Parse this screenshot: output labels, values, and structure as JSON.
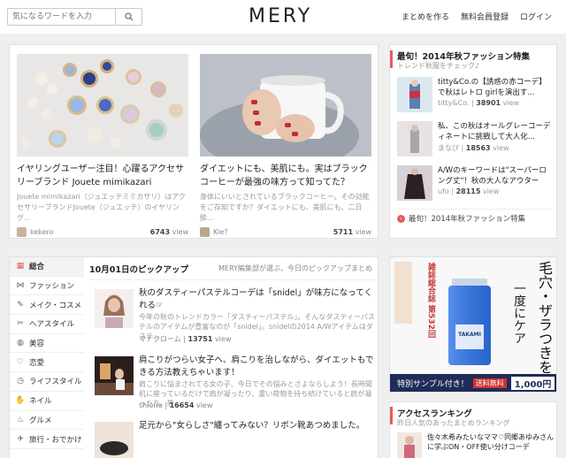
{
  "header": {
    "search_placeholder": "気になるワードを入力",
    "logo": "MERY",
    "nav": [
      "まとめを作る",
      "無料会員登録",
      "ログイン"
    ]
  },
  "featured": [
    {
      "title": "イヤリングユーザー注目！心躍るアクセサリーブランド Jouete mimikazari",
      "desc": "Jouete mimikazari（ジュエッテミミカザリ）はアクセサリーブランドJouete（ジュエッテ）のイヤリング...",
      "author": "kekero",
      "views": "6743",
      "views_unit": "view"
    },
    {
      "title": "ダイエットにも、美肌にも。実はブラックコーヒーが最強の味方って知ってた？",
      "desc": "身体にいいとされているブラックコーヒー。その効能をご存知ですか？ダイエットにも、美肌にも、二日酔...",
      "author": "Kie？",
      "views": "5711",
      "views_unit": "view"
    }
  ],
  "special": {
    "title": "最旬！2014年秋ファッション特集",
    "subtitle": "トレンド秋服をチェック♪",
    "items": [
      {
        "title": "titty&Co.の【誘惑の赤コーデ】で秋はレトロ girlを演出す...",
        "author": "titty&Co.",
        "views": "38901",
        "views_unit": "view"
      },
      {
        "title": "私、この秋はオールグレーコーディネートに挑戦して大人化...",
        "author": "まなび",
        "views": "18563",
        "views_unit": "view"
      },
      {
        "title": "A/Wのキーワードは\"スーパーロング丈\"！秋の大人なアウターを...",
        "author": "ufo",
        "views": "28115",
        "views_unit": "view"
      }
    ],
    "more": "最旬！2014年秋ファッション特集"
  },
  "categories": [
    {
      "icon": "all-icon",
      "glyph": "▦",
      "label": "総合",
      "active": true
    },
    {
      "icon": "ribbon-icon",
      "glyph": "⋈",
      "label": "ファッション",
      "active": false
    },
    {
      "icon": "makeup-icon",
      "glyph": "✎",
      "label": "メイク・コスメ",
      "active": false
    },
    {
      "icon": "scissors-icon",
      "glyph": "✂",
      "label": "ヘアスタイル",
      "active": false
    },
    {
      "icon": "beauty-icon",
      "glyph": "◍",
      "label": "美容",
      "active": false
    },
    {
      "icon": "heart-icon",
      "glyph": "♡",
      "label": "恋愛",
      "active": false
    },
    {
      "icon": "clock-icon",
      "glyph": "◷",
      "label": "ライフスタイル",
      "active": false
    },
    {
      "icon": "nail-icon",
      "glyph": "✋",
      "label": "ネイル",
      "active": false
    },
    {
      "icon": "gourmet-icon",
      "glyph": "♨",
      "label": "グルメ",
      "active": false
    },
    {
      "icon": "plane-icon",
      "glyph": "✈",
      "label": "旅行・おでかけ",
      "active": false
    }
  ],
  "pickup": {
    "title": "10月01日のピックアップ",
    "subtitle": "MERY編集部が選ぶ、今日のピックアップまとめ",
    "items": [
      {
        "title": "秋のダスティーパステルコーデは「snidel」が味方になってくれる☞",
        "desc": "今年の秋のトレンドカラー「ダスティーパステル」。そんなダスティーパステルのアイテムが豊富なのが「snidel」。snidelの2014 A/Wアイテムはダステ...",
        "author": "マナクローム",
        "views": "13751",
        "views_unit": "view"
      },
      {
        "title": "肩こりがつらい女子へ、肩こりを治しながら、ダイエットもできる方法教えちゃいます！",
        "desc": "肩こりに悩まされてる女の子、今日でその悩みとさよならしよう！長時間机に座っているだけで肩が凝ったり、重い荷物を持ち続けていると肩が凝ったり、悪...",
        "author": "shiorie",
        "views": "16654",
        "views_unit": "view"
      },
      {
        "title": "足元から\"女らしさ\"纏ってみない？リボン靴あつめました。",
        "desc": "",
        "author": "",
        "views": "",
        "views_unit": ""
      }
    ]
  },
  "ad": {
    "line1": "毛穴・ザラつきを",
    "line2": "一度にケア",
    "badge": "雑誌総合誌 第532回",
    "product": "TAKAMI",
    "footer_text": "特別サンプル付き！",
    "shipping": "送料無料",
    "price": "1,000円"
  },
  "ranking": {
    "title": "アクセスランキング",
    "subtitle": "昨日人気のあったまとめランキング",
    "item": "佐々木希みたいなママ♡同郷あゆみさんに学ぶON・OFF使い分けコーデ"
  },
  "colors": {
    "accent": "#e85a5a",
    "ad_navy": "#1f2c57",
    "background": "#efefef"
  }
}
